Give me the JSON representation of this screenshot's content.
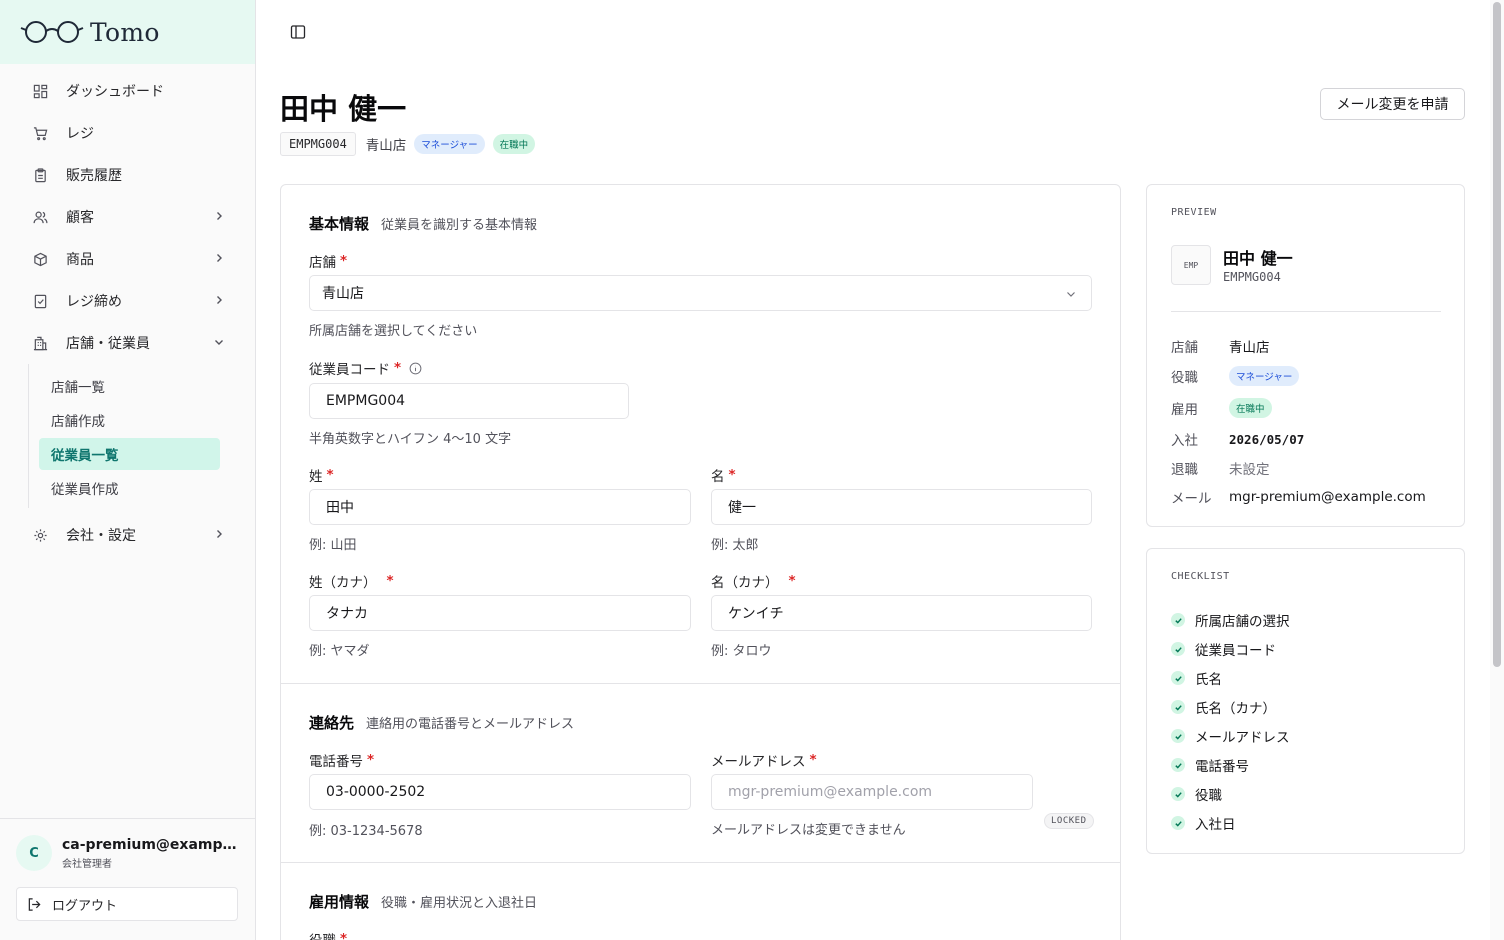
{
  "brand": {
    "name": "Tomo"
  },
  "sidebar": {
    "items": [
      {
        "label": "ダッシュボード",
        "icon": "dashboard-icon"
      },
      {
        "label": "レジ",
        "icon": "cart-icon"
      },
      {
        "label": "販売履歴",
        "icon": "clipboard-icon"
      },
      {
        "label": "顧客",
        "icon": "users-icon"
      },
      {
        "label": "商品",
        "icon": "box-icon"
      },
      {
        "label": "レジ締め",
        "icon": "receipt-icon"
      },
      {
        "label": "店舗・従業員",
        "icon": "building-icon"
      },
      {
        "label": "会社・設定",
        "icon": "gear-icon"
      }
    ],
    "subitems": [
      "店舗一覧",
      "店舗作成",
      "従業員一覧",
      "従業員作成"
    ],
    "active_subitem": "従業員一覧"
  },
  "user": {
    "initial": "C",
    "email": "ca-premium@example.com",
    "role": "会社管理者",
    "logout_label": "ログアウト"
  },
  "header": {
    "title": "田中 健一",
    "code": "EMPMG004",
    "store": "青山店",
    "role_badge": "マネージャー",
    "status_badge": "在職中",
    "email_change_button": "メール変更を申請"
  },
  "form": {
    "basic": {
      "title": "基本情報",
      "desc": "従業員を識別する基本情報",
      "store_label": "店舗",
      "store_value": "青山店",
      "store_hint": "所属店舗を選択してください",
      "code_label": "従業員コード",
      "code_value": "EMPMG004",
      "code_hint": "半角英数字とハイフン 4〜10 文字",
      "last_name_label": "姓",
      "last_name_value": "田中",
      "last_name_hint": "例: 山田",
      "first_name_label": "名",
      "first_name_value": "健一",
      "first_name_hint": "例: 太郎",
      "last_kana_label": "姓（カナ）",
      "last_kana_value": "タナカ",
      "last_kana_hint": "例: ヤマダ",
      "first_kana_label": "名（カナ）",
      "first_kana_value": "ケンイチ",
      "first_kana_hint": "例: タロウ"
    },
    "contact": {
      "title": "連絡先",
      "desc": "連絡用の電話番号とメールアドレス",
      "phone_label": "電話番号",
      "phone_value": "03-0000-2502",
      "phone_hint": "例: 03-1234-5678",
      "email_label": "メールアドレス",
      "email_value": "mgr-premium@example.com",
      "email_hint": "メールアドレスは変更できません",
      "locked_badge": "LOCKED"
    },
    "employment": {
      "title": "雇用情報",
      "desc": "役職・雇用状況と入退社日",
      "role_label": "役職"
    }
  },
  "preview": {
    "caption": "PREVIEW",
    "avatar_text": "EMP",
    "name": "田中 健一",
    "code": "EMPMG004",
    "rows": {
      "store_key": "店舗",
      "store_val": "青山店",
      "role_key": "役職",
      "role_val": "マネージャー",
      "employment_key": "雇用",
      "employment_val": "在職中",
      "joined_key": "入社",
      "joined_val": "2026/05/07",
      "left_key": "退職",
      "left_val": "未設定",
      "email_key": "メール",
      "email_val": "mgr-premium@example.com"
    }
  },
  "checklist": {
    "caption": "CHECKLIST",
    "items": [
      "所属店舗の選択",
      "従業員コード",
      "氏名",
      "氏名（カナ）",
      "メールアドレス",
      "電話番号",
      "役職",
      "入社日"
    ]
  },
  "required_mark": "*"
}
